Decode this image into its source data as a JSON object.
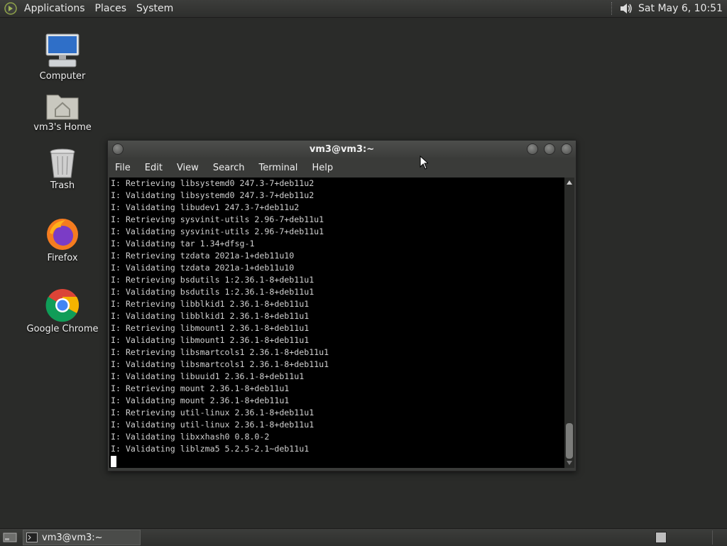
{
  "top_panel": {
    "menus": [
      "Applications",
      "Places",
      "System"
    ],
    "clock": "Sat May  6, 10:51"
  },
  "desktop": {
    "icons": [
      {
        "label": "Computer",
        "icon": "computer-icon"
      },
      {
        "label": "vm3's Home",
        "icon": "home-folder-icon"
      },
      {
        "label": "Trash",
        "icon": "trash-icon"
      },
      {
        "label": "Firefox",
        "icon": "firefox-icon"
      },
      {
        "label": "Google Chrome",
        "icon": "chrome-icon"
      }
    ]
  },
  "terminal": {
    "title": "vm3@vm3:~",
    "menu": [
      "File",
      "Edit",
      "View",
      "Search",
      "Terminal",
      "Help"
    ],
    "lines": [
      "I: Retrieving libsystemd0 247.3-7+deb11u2",
      "I: Validating libsystemd0 247.3-7+deb11u2",
      "I: Validating libudev1 247.3-7+deb11u2",
      "I: Retrieving sysvinit-utils 2.96-7+deb11u1",
      "I: Validating sysvinit-utils 2.96-7+deb11u1",
      "I: Validating tar 1.34+dfsg-1",
      "I: Retrieving tzdata 2021a-1+deb11u10",
      "I: Validating tzdata 2021a-1+deb11u10",
      "I: Retrieving bsdutils 1:2.36.1-8+deb11u1",
      "I: Validating bsdutils 1:2.36.1-8+deb11u1",
      "I: Retrieving libblkid1 2.36.1-8+deb11u1",
      "I: Validating libblkid1 2.36.1-8+deb11u1",
      "I: Retrieving libmount1 2.36.1-8+deb11u1",
      "I: Validating libmount1 2.36.1-8+deb11u1",
      "I: Retrieving libsmartcols1 2.36.1-8+deb11u1",
      "I: Validating libsmartcols1 2.36.1-8+deb11u1",
      "I: Validating libuuid1 2.36.1-8+deb11u1",
      "I: Retrieving mount 2.36.1-8+deb11u1",
      "I: Validating mount 2.36.1-8+deb11u1",
      "I: Retrieving util-linux 2.36.1-8+deb11u1",
      "I: Validating util-linux 2.36.1-8+deb11u1",
      "I: Validating libxxhash0 0.8.0-2",
      "I: Validating liblzma5 5.2.5-2.1~deb11u1"
    ]
  },
  "taskbar": {
    "window_button": "vm3@vm3:~"
  }
}
